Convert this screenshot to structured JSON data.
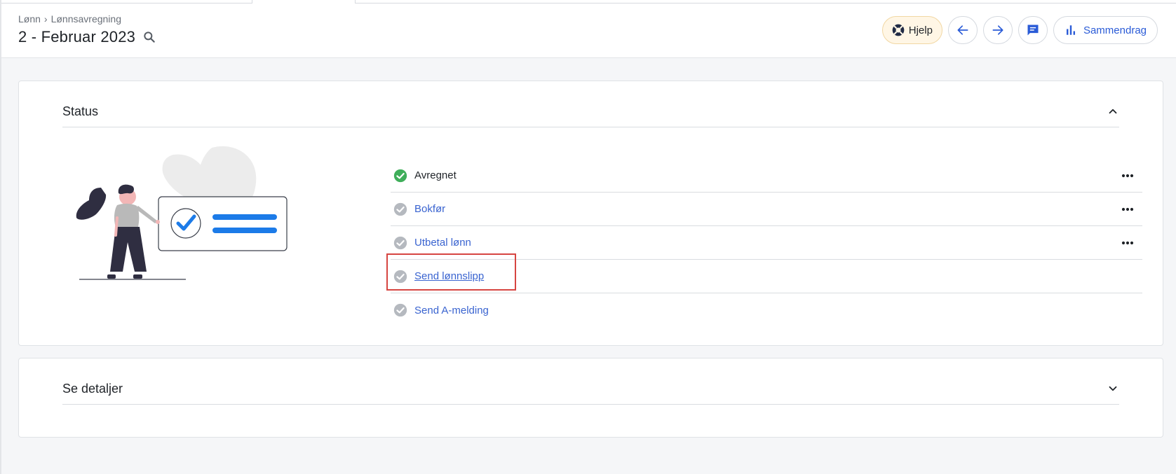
{
  "breadcrumb": {
    "parent": "Lønn",
    "separator": "›",
    "current": "Lønnsavregning"
  },
  "page": {
    "title": "2 - Februar 2023"
  },
  "toolbar": {
    "help_label": "Hjelp",
    "summary_label": "Sammendrag"
  },
  "status_section": {
    "title": "Status",
    "steps": [
      {
        "label": "Avregnet",
        "state": "done",
        "has_menu": true
      },
      {
        "label": "Bokfør",
        "state": "pending",
        "has_menu": true
      },
      {
        "label": "Utbetal lønn",
        "state": "pending",
        "has_menu": true
      },
      {
        "label": "Send lønnslipp",
        "state": "pending",
        "has_menu": false,
        "highlighted": true
      },
      {
        "label": "Send A-melding",
        "state": "pending",
        "has_menu": false
      }
    ]
  },
  "details_section": {
    "title": "Se detaljer"
  },
  "colors": {
    "accent": "#3a64d0",
    "done_green": "#3fae5a",
    "pending_gray": "#b5b9bf",
    "highlight_red": "#d64541",
    "help_bg": "#fff6e5"
  },
  "icons": {
    "search": "search-icon",
    "help": "lifebuoy-icon",
    "back": "arrow-left-icon",
    "forward": "arrow-right-icon",
    "chat": "chat-icon",
    "summary": "bar-chart-icon",
    "collapse": "chevron-up-icon",
    "expand": "chevron-down-icon",
    "more": "more-horizontal-icon",
    "check": "check-circle-icon"
  }
}
